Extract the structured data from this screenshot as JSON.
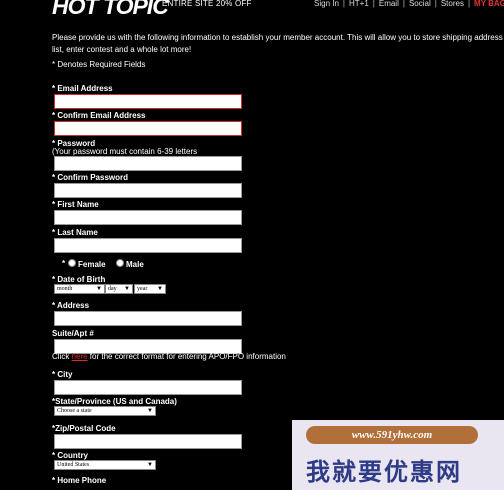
{
  "header": {
    "logo": "HOT TOPIC",
    "promo": "ENTIRE SITE 20% OFF",
    "nav": [
      "Sign In",
      "HT+1",
      "Email",
      "Social",
      "Stores",
      "MY BAG"
    ]
  },
  "intro_text": "Please provide us with the following information to establish your member account. This will allow you to store shipping address list, enter contest and a whole lot more!",
  "required_note": "* Denotes Required Fields",
  "fields": {
    "email": {
      "label": "* Email Address",
      "value": ""
    },
    "confirm_email": {
      "label": "* Confirm Email Address",
      "value": ""
    },
    "password": {
      "label": "* Password",
      "hint": "(Your password must contain 6-39 letters",
      "value": ""
    },
    "confirm_password": {
      "label": "* Confirm Password",
      "value": ""
    },
    "first_name": {
      "label": "* First Name",
      "value": ""
    },
    "last_name": {
      "label": "* Last Name",
      "value": ""
    },
    "gender": {
      "prefix": "*",
      "female": "Female",
      "male": "Male"
    },
    "dob": {
      "label": "* Date of Birth",
      "month": "month",
      "day": "day",
      "year": "year"
    },
    "address": {
      "label": "* Address",
      "value": ""
    },
    "suite": {
      "label": "Suite/Apt #",
      "value": ""
    },
    "city": {
      "label": "* City",
      "value": ""
    },
    "state": {
      "label": "*State/Province (US and Canada)",
      "selected": "Choose a state"
    },
    "zip": {
      "label": "*Zip/Postal Code",
      "value": ""
    },
    "country": {
      "label": "* Country",
      "selected": "United States"
    },
    "home_phone": {
      "label": "* Home Phone"
    }
  },
  "apo_note": {
    "before": "Click ",
    "link": "here",
    "after": " for the correct format for entering APO/FPO information"
  },
  "watermark": {
    "url": "www.591yhw.com",
    "text": "我就要优惠网"
  },
  "colors": {
    "background": "#000000",
    "error_border": "#d42b2b",
    "bag": "#e3342f",
    "watermark_bg": "#e9e5f1",
    "watermark_text": "#2e3b86"
  }
}
